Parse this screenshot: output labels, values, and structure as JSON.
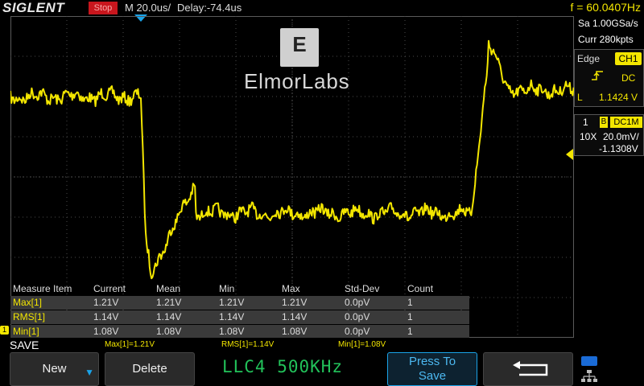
{
  "header": {
    "brand": "SIGLENT",
    "run_state": "Stop",
    "timebase": "M 20.0us/",
    "delay": "Delay:-74.4us",
    "frequency": "f = 60.0407Hz"
  },
  "watermark": {
    "logo_letter": "E",
    "name": "ElmorLabs"
  },
  "acquisition": {
    "sample_rate": "Sa 1.00GSa/s",
    "memory_depth": "Curr 280kpts"
  },
  "trigger": {
    "type": "Edge",
    "source": "CH1",
    "coupling": "DC",
    "level_label": "L",
    "level": "1.1424 V"
  },
  "channel": {
    "number": "1",
    "bw_flag": "B",
    "coupling": "DC1M",
    "probe": "10X",
    "scale": "20.0mV/",
    "offset": "-1.1308V",
    "color": "#f3e600"
  },
  "measure_table": {
    "headers": [
      "Measure Item",
      "Current",
      "Mean",
      "Min",
      "Max",
      "Std-Dev",
      "Count"
    ],
    "rows": [
      [
        "Max[1]",
        "1.21V",
        "1.21V",
        "1.21V",
        "1.21V",
        "0.0pV",
        "1"
      ],
      [
        "RMS[1]",
        "1.14V",
        "1.14V",
        "1.14V",
        "1.14V",
        "0.0pV",
        "1"
      ],
      [
        "Min[1]",
        "1.08V",
        "1.08V",
        "1.08V",
        "1.08V",
        "0.0pV",
        "1"
      ]
    ]
  },
  "status": {
    "menu_title": "SAVE",
    "max_readout": "Max[1]=1.21V",
    "rms_readout": "RMS[1]=1.14V",
    "min_readout": "Min[1]=1.08V"
  },
  "softkeys": {
    "new_label": "New",
    "delete_label": "Delete",
    "filename": "LLC4 500KHz",
    "press_line1": "Press To",
    "press_line2": "Save"
  },
  "icons": {
    "trigger_position": "trigger-position-marker-icon",
    "trigger_level": "trigger-level-marker-icon",
    "slope": "rising-edge-icon",
    "back": "return-arrow-icon",
    "usb": "usb-icon",
    "network": "network-icon"
  },
  "colors": {
    "trace": "#f3e600",
    "accent": "#1aa3e8",
    "stop": "#c8161d",
    "filename": "#22c25a"
  }
}
